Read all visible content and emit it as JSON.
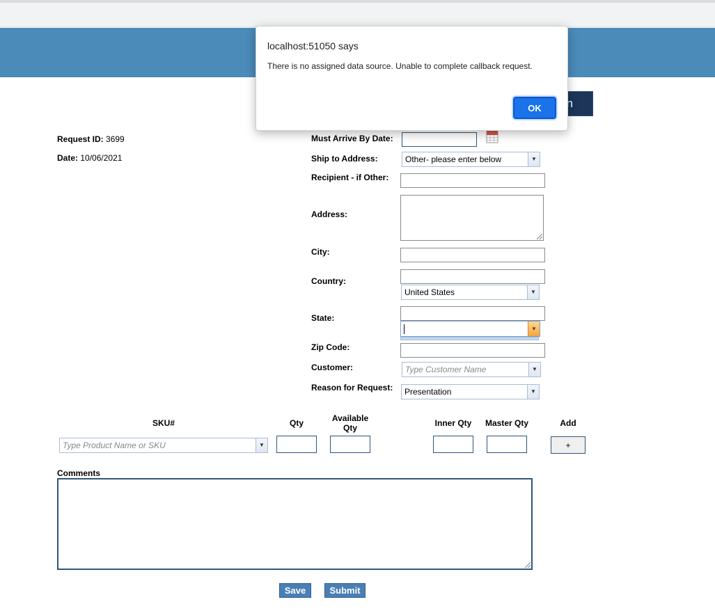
{
  "dialog": {
    "title": "localhost:51050 says",
    "message": "There is no assigned data source. Unable to complete callback request.",
    "ok_label": "OK"
  },
  "header": {
    "hidden_button_fragment": "n"
  },
  "request": {
    "id_label": "Request ID:",
    "id_value": "3699",
    "date_label": "Date:",
    "date_value": "10/06/2021"
  },
  "form": {
    "must_arrive_label": "Must Arrive By Date:",
    "ship_to_label": "Ship to Address:",
    "ship_to_value": "Other- please enter below",
    "recipient_label": "Recipient - if Other:",
    "address_label": "Address:",
    "city_label": "City:",
    "country_label": "Country:",
    "country_value": "United States",
    "state_label": "State:",
    "state_value": "",
    "zip_label": "Zip Code:",
    "customer_label": "Customer:",
    "customer_placeholder": "Type Customer Name",
    "reason_label": "Reason for Request:",
    "reason_value": "Presentation"
  },
  "sku_table": {
    "headers": {
      "sku": "SKU#",
      "qty": "Qty",
      "available_qty_line1": "Available",
      "available_qty_line2": "Qty",
      "inner_qty": "Inner Qty",
      "master_qty": "Master Qty",
      "add": "Add"
    },
    "sku_placeholder": "Type Product Name or SKU",
    "add_button": "+"
  },
  "comments": {
    "label": "Comments"
  },
  "actions": {
    "save": "Save",
    "submit": "Submit"
  },
  "colors": {
    "banner": "#4a8bba",
    "dialog_ok": "#1a73e8",
    "action_button": "#4a7fb5",
    "navy_button": "#1c3559"
  }
}
